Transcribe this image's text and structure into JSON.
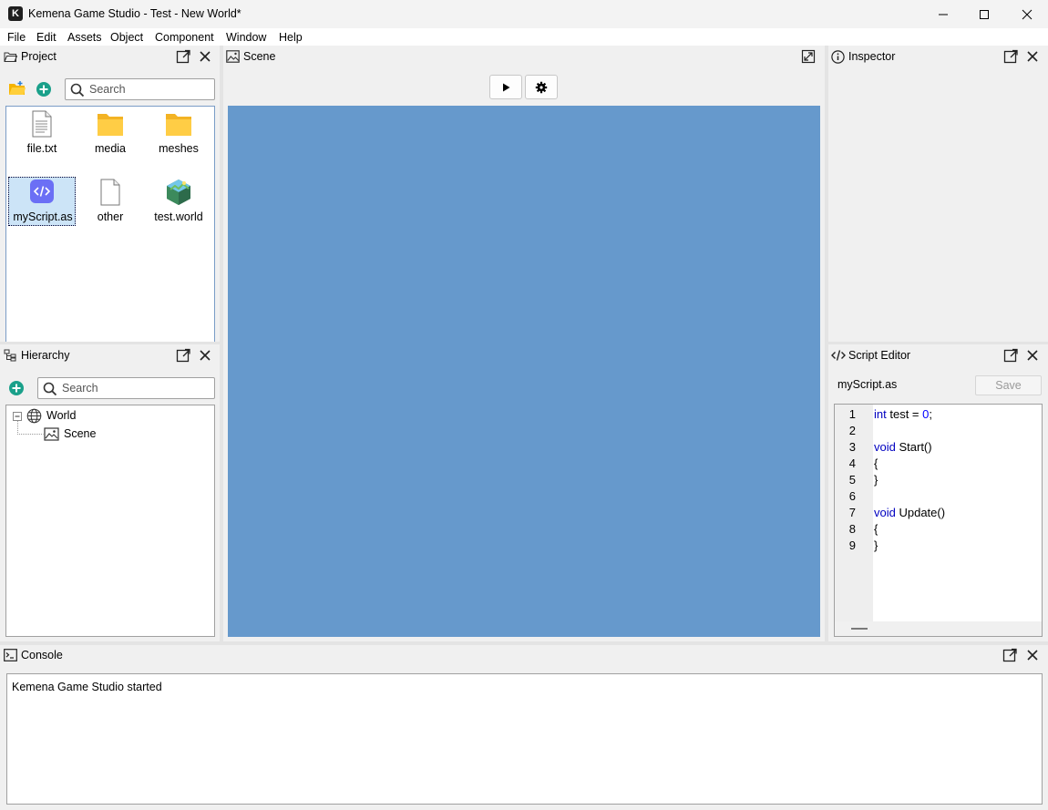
{
  "window": {
    "title": "Kemena Game Studio - Test - New World*",
    "logo_letter": "K"
  },
  "menu": [
    "File",
    "Edit",
    "Assets",
    "Object",
    "Component",
    "Window",
    "Help"
  ],
  "project": {
    "title": "Project",
    "search_placeholder": "Search",
    "files": [
      {
        "name": "file.txt",
        "icon": "text-file-icon"
      },
      {
        "name": "media",
        "icon": "folder-icon"
      },
      {
        "name": "meshes",
        "icon": "folder-icon"
      },
      {
        "name": "myScript.as",
        "icon": "script-file-icon",
        "selected": true
      },
      {
        "name": "other",
        "icon": "blank-file-icon"
      },
      {
        "name": "test.world",
        "icon": "world-file-icon"
      }
    ]
  },
  "hierarchy": {
    "title": "Hierarchy",
    "search_placeholder": "Search",
    "tree": [
      {
        "label": "World",
        "icon": "globe-icon"
      },
      {
        "label": "Scene",
        "icon": "scene-icon"
      }
    ]
  },
  "scene": {
    "title": "Scene",
    "viewport_color": "#6699cc"
  },
  "inspector": {
    "title": "Inspector"
  },
  "script_editor": {
    "title": "Script Editor",
    "filename": "myScript.as",
    "save_label": "Save",
    "lines": [
      {
        "n": "1",
        "kw": "int",
        "rest": " test = ",
        "num": "0",
        "tail": ";"
      },
      {
        "n": "2",
        "kw": "",
        "rest": "",
        "num": "",
        "tail": ""
      },
      {
        "n": "3",
        "kw": "void",
        "rest": " Start()",
        "num": "",
        "tail": ""
      },
      {
        "n": "4",
        "kw": "",
        "rest": "{",
        "num": "",
        "tail": ""
      },
      {
        "n": "5",
        "kw": "",
        "rest": "}",
        "num": "",
        "tail": ""
      },
      {
        "n": "6",
        "kw": "",
        "rest": "",
        "num": "",
        "tail": ""
      },
      {
        "n": "7",
        "kw": "void",
        "rest": " Update()",
        "num": "",
        "tail": ""
      },
      {
        "n": "8",
        "kw": "",
        "rest": "{",
        "num": "",
        "tail": ""
      },
      {
        "n": "9",
        "kw": "",
        "rest": "}",
        "num": "",
        "tail": ""
      }
    ]
  },
  "console": {
    "title": "Console",
    "messages": [
      "Kemena Game Studio started"
    ]
  }
}
